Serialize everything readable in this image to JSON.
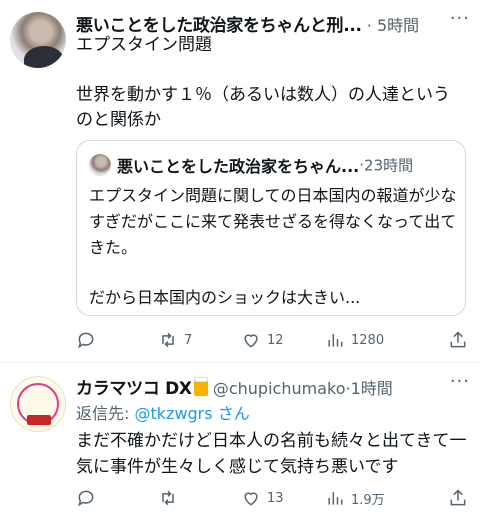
{
  "tweet1": {
    "author": "悪いことをした政治家をちゃんと刑...",
    "separator": "·",
    "time": "5時間",
    "more": "···",
    "text_line1": "エプスタイン問題",
    "text_line2": "世界を動かす１％（あるいは数人）の人達というのと関係か",
    "quote": {
      "author": "悪いことをした政治家をちゃん...",
      "separator": "·",
      "time": "23時間",
      "text1": "エプスタイン問題に関しての日本国内の報道が少なすぎだがここに来て発表せざるを得なくなって出てきた。",
      "text2": "だから日本国内のショックは大きい..."
    },
    "actions": {
      "reply_count": "",
      "retweet_count": "7",
      "like_count": "12",
      "views_count": "1280"
    }
  },
  "tweet2": {
    "author": "カラマツコ DX",
    "handle": "@chupichumako",
    "separator": "·",
    "time": "1時間",
    "more": "···",
    "reply_label": "返信先:",
    "reply_handle": "@tkzwgrs",
    "reply_suffix": "さん",
    "text": "まだ不確かだけど日本人の名前も続々と出てきて一気に事件が生々しく感じて気持ち悪いです",
    "actions": {
      "reply_count": "",
      "retweet_count": "",
      "like_count": "13",
      "views_count": "1.9万"
    }
  },
  "icons": [
    "reply-icon",
    "retweet-icon",
    "like-icon",
    "views-icon",
    "share-icon",
    "more-icon",
    "beer-icon"
  ],
  "colors": {
    "text": "#0f1419",
    "secondary": "#536471",
    "link": "#1d9bf0",
    "border": "#cfd9de"
  }
}
